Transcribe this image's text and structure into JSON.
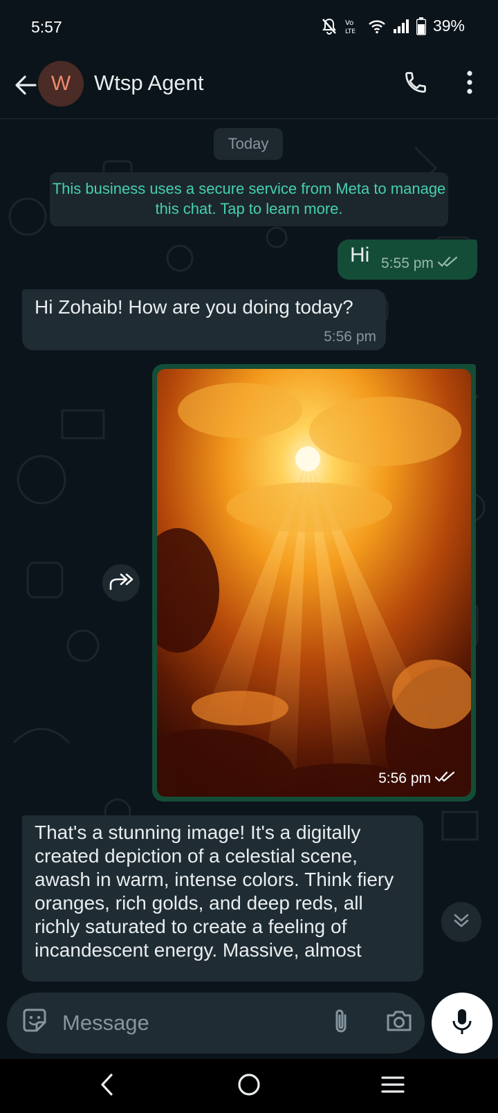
{
  "status_bar": {
    "time": "5:57",
    "battery": "39%",
    "icons": [
      "mute-bell-icon",
      "volte-icon",
      "wifi-icon",
      "signal-icon",
      "battery-icon"
    ]
  },
  "header": {
    "avatar_initial": "W",
    "contact_name": "Wtsp Agent",
    "icons": [
      "back-arrow-icon",
      "phone-icon",
      "more-vert-icon"
    ]
  },
  "chat": {
    "date_label": "Today",
    "system_note": "This business uses a secure service from Meta to manage this chat. Tap to learn more.",
    "messages": [
      {
        "direction": "out",
        "type": "text",
        "text": "Hi",
        "time": "5:55 pm",
        "status": "read"
      },
      {
        "direction": "in",
        "type": "text",
        "text": "Hi Zohaib!  How are you doing today?",
        "time": "5:56 pm"
      },
      {
        "direction": "out",
        "type": "image",
        "image_desc": "fiery orange celestial clouds with sun rays",
        "time": "5:56 pm",
        "status": "read"
      },
      {
        "direction": "in",
        "type": "text",
        "text": "That's a stunning image!  It's a digitally created depiction of a celestial scene, awash in warm, intense colors.  Think fiery oranges, rich golds, and deep reds, all richly saturated to create a feeling of incandescent energy.  Massive, almost"
      }
    ]
  },
  "composer": {
    "placeholder": "Message",
    "icons": [
      "sticker-icon",
      "attach-icon",
      "camera-icon",
      "mic-icon"
    ]
  },
  "nav": {
    "icons": [
      "nav-back-icon",
      "nav-home-icon",
      "nav-recents-icon"
    ]
  },
  "colors": {
    "background": "#0b141a",
    "outgoing_bubble": "#144d37",
    "incoming_bubble": "#1f2c33",
    "system_note_text": "#46d0b0",
    "read_ticks": "#9ab8a8"
  }
}
